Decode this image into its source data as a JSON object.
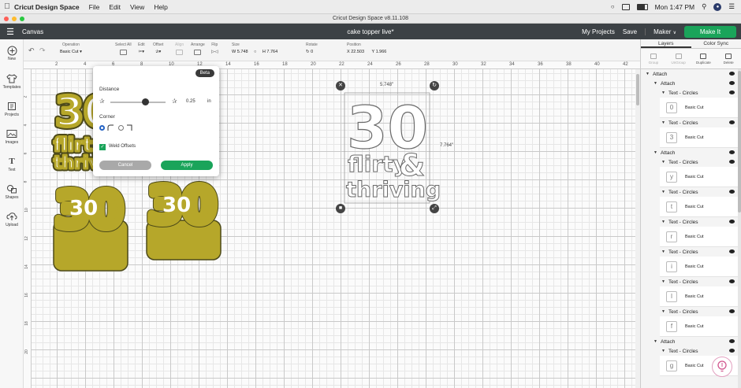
{
  "menubar": {
    "app_name": "Cricut Design Space",
    "menus": [
      "File",
      "Edit",
      "View",
      "Help"
    ],
    "clock": "Mon 1:47 PM"
  },
  "window": {
    "title": "Cricut Design Space  v8.11.108"
  },
  "header": {
    "canvas_label": "Canvas",
    "project_title": "cake topper live*",
    "my_projects": "My Projects",
    "save": "Save",
    "maker": "Maker",
    "make_it": "Make It"
  },
  "toolbar": {
    "operation_label": "Operation",
    "operation_value": "Basic Cut",
    "select_all": "Select All",
    "edit": "Edit",
    "offset": "Offset",
    "align": "Align",
    "arrange": "Arrange",
    "flip": "Flip",
    "size_label": "Size",
    "w_label": "W",
    "w_value": "5.748",
    "h_label": "H",
    "h_value": "7.764",
    "rotate_label": "Rotate",
    "rotate_value": "0",
    "position_label": "Position",
    "x_label": "X",
    "x_value": "22.503",
    "y_label": "Y",
    "y_value": "1.966"
  },
  "leftbar": [
    {
      "label": "New",
      "icon": "plus-circle-icon"
    },
    {
      "label": "Templates",
      "icon": "shirt-icon"
    },
    {
      "label": "Projects",
      "icon": "projects-icon"
    },
    {
      "label": "Images",
      "icon": "image-icon"
    },
    {
      "label": "Text",
      "icon": "text-icon"
    },
    {
      "label": "Shapes",
      "icon": "shapes-icon"
    },
    {
      "label": "Upload",
      "icon": "upload-icon"
    }
  ],
  "ruler": {
    "top_ticks": [
      "2",
      "4",
      "6",
      "8",
      "10",
      "12",
      "14",
      "16",
      "18",
      "20",
      "22",
      "24",
      "26",
      "28",
      "30",
      "32",
      "34",
      "36",
      "38",
      "40",
      "42"
    ],
    "left_ticks": [
      "2",
      "4",
      "6",
      "8",
      "10",
      "12",
      "14",
      "16",
      "18",
      "20"
    ]
  },
  "offset_popup": {
    "beta": "Beta",
    "distance_label": "Distance",
    "distance_value": "0.25",
    "unit": "in",
    "corner_label": "Corner",
    "weld_label": "Weld Offsets",
    "cancel": "Cancel",
    "apply": "Apply"
  },
  "design": {
    "line1": "30",
    "line2": "flirty",
    "amp": "&",
    "line3": "thriving",
    "width_readout": "5.748\"",
    "height_readout": "7.764\""
  },
  "colors": {
    "offset_fill": "#b6a72a",
    "offset_stroke": "#4d4a19",
    "header_bg": "#3c4145",
    "make_it_green": "#1aa45a"
  },
  "layers_panel": {
    "tabs": [
      "Layers",
      "Color Sync"
    ],
    "actions": [
      {
        "label": "Group",
        "disabled": true
      },
      {
        "label": "UnGroup",
        "disabled": true
      },
      {
        "label": "Duplicate",
        "disabled": false
      },
      {
        "label": "Delete",
        "disabled": false
      }
    ],
    "attach": "Attach",
    "text_circles": "Text - Circles",
    "basic_cut": "Basic Cut"
  }
}
